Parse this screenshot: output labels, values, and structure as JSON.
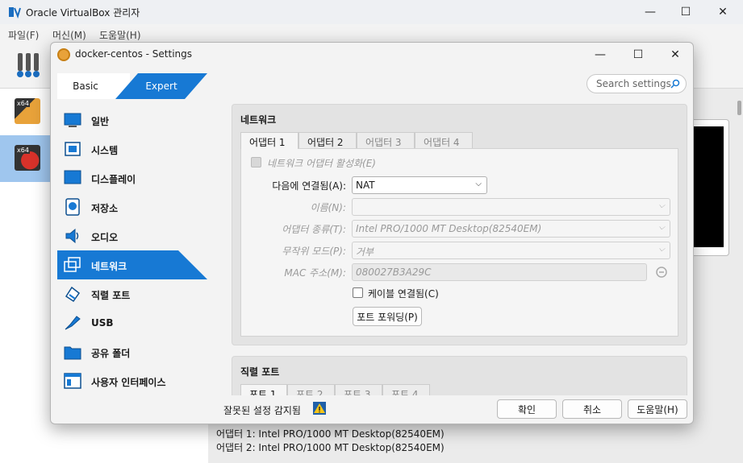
{
  "main_window": {
    "title": "Oracle VirtualBox 관리자",
    "menu": [
      "파일(F)",
      "머신(M)",
      "도움말(H)"
    ],
    "vm_thumbs": [
      "x64",
      "x64"
    ],
    "details": [
      "어댑터 1:  Intel PRO/1000 MT Desktop(82540EM)",
      "어댑터 2:  Intel PRO/1000 MT Desktop(82540EM)"
    ]
  },
  "dialog": {
    "title": "docker-centos - Settings",
    "mode_basic": "Basic",
    "mode_expert": "Expert",
    "search_placeholder": "Search settings",
    "nav": [
      {
        "label": "일반",
        "icon": "general-icon"
      },
      {
        "label": "시스템",
        "icon": "system-icon"
      },
      {
        "label": "디스플레이",
        "icon": "display-icon"
      },
      {
        "label": "저장소",
        "icon": "storage-icon"
      },
      {
        "label": "오디오",
        "icon": "audio-icon"
      },
      {
        "label": "네트워크",
        "icon": "network-icon",
        "selected": true
      },
      {
        "label": "직렬 포트",
        "icon": "serial-port-icon"
      },
      {
        "label": "USB",
        "icon": "usb-icon"
      },
      {
        "label": "공유 폴더",
        "icon": "shared-folder-icon"
      },
      {
        "label": "사용자 인터페이스",
        "icon": "user-interface-icon"
      }
    ],
    "network": {
      "title": "네트워크",
      "tabs": [
        "어댑터 1",
        "어댑터 2",
        "어댑터 3",
        "어댑터 4"
      ],
      "enable_label": "네트워크 어댑터 활성화(E)",
      "attached_label": "다음에 연결됨(A):",
      "attached_value": "NAT",
      "name_label": "이름(N):",
      "name_value": "",
      "adapter_type_label": "어댑터 종류(T):",
      "adapter_type_value": "Intel PRO/1000 MT Desktop(82540EM)",
      "promisc_label": "무작위 모드(P):",
      "promisc_value": "거부",
      "mac_label": "MAC 주소(M):",
      "mac_value": "080027B3A29C",
      "cable_label": "케이블 연결됨(C)",
      "port_forward_label": "포트 포워딩(P)"
    },
    "serial": {
      "title": "직렬 포트",
      "tabs": [
        "포트 1",
        "포트 2",
        "포트 3",
        "포트 4"
      ]
    },
    "footer": {
      "invalid_label": "잘못된 설정 감지됨",
      "ok": "확인",
      "cancel": "취소",
      "help": "도움말(H)"
    }
  }
}
